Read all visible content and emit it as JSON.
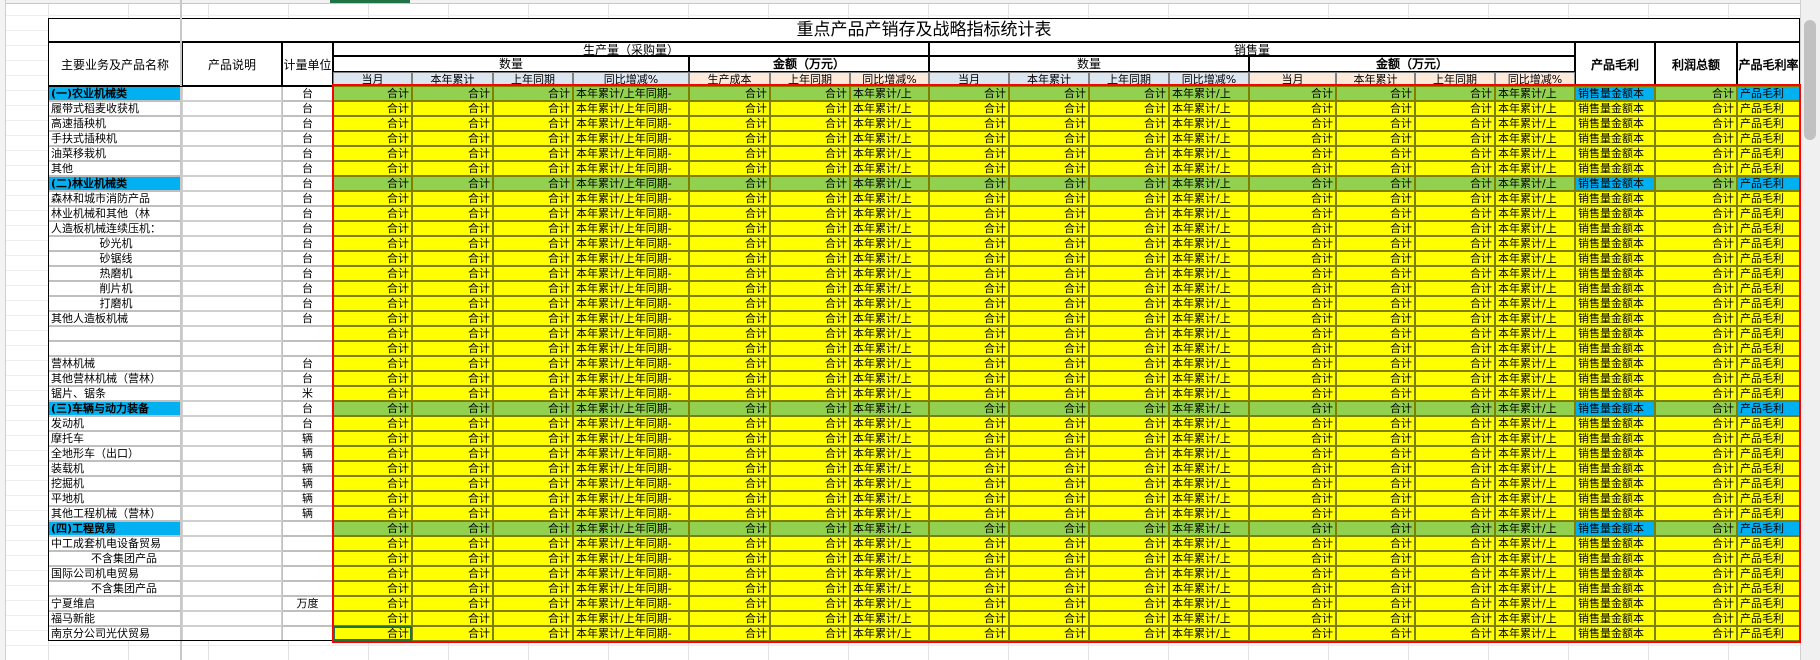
{
  "sheet": {
    "title": "重点产品产销存及战略指标统计表",
    "header": {
      "main_col": "主要业务及产品名称",
      "desc_col": "产品说明",
      "unit_col": "计量单位",
      "production": "生产量（采购量）",
      "sales": "销售量",
      "qty": "数量",
      "amount": "金额（万元）",
      "gross_profit": "产品毛利",
      "profit_total": "利润总额",
      "gross_profit_rate": "产品毛利率",
      "sub_prod": [
        "当月",
        "本年累计",
        "上年同期",
        "同比增减%",
        "生产成本",
        "上年同期",
        "同比增减%"
      ],
      "sub_sales": [
        "当月",
        "本年累计",
        "上年同期",
        "同比增减%",
        "当月",
        "本年累计",
        "上年同期",
        "同比增减%"
      ]
    },
    "cell_text": {
      "sum": "合计",
      "ratio": "本年累计/上年同期-",
      "ratio_short": "本年累计/上",
      "sales_amt": "销售量金额本",
      "gm": "产品毛利"
    },
    "colors": {
      "yellow": "#ffff00",
      "green": "#92d050",
      "blue": "#00b0f0",
      "prod_hdr": "#dce6f1",
      "amt_hdr": "#fde9d9",
      "red_border": "#ff0000"
    },
    "rows": [
      {
        "name": "(一)农业机械类",
        "unit": "台",
        "type": "cat"
      },
      {
        "name": "履带式稻麦收获机",
        "unit": "台",
        "type": "item"
      },
      {
        "name": "高速插秧机",
        "unit": "台",
        "type": "item"
      },
      {
        "name": "手扶式插秧机",
        "unit": "台",
        "type": "item"
      },
      {
        "name": "油菜移栽机",
        "unit": "台",
        "type": "item"
      },
      {
        "name": "其他",
        "unit": "台",
        "type": "item"
      },
      {
        "name": "(二)林业机械类",
        "unit": "台",
        "type": "cat"
      },
      {
        "name": "森林和城市消防产品",
        "unit": "台",
        "type": "item"
      },
      {
        "name": "林业机械和其他（林",
        "unit": "台",
        "type": "item"
      },
      {
        "name": "人造板机械连续压机：",
        "unit": "台",
        "type": "item"
      },
      {
        "name": "砂光机",
        "unit": "台",
        "type": "sub"
      },
      {
        "name": "砂锯线",
        "unit": "台",
        "type": "sub"
      },
      {
        "name": "热磨机",
        "unit": "台",
        "type": "sub"
      },
      {
        "name": "削片机",
        "unit": "台",
        "type": "sub"
      },
      {
        "name": "打磨机",
        "unit": "台",
        "type": "sub"
      },
      {
        "name": "其他人造板机械",
        "unit": "台",
        "type": "item"
      },
      {
        "name": "",
        "unit": "",
        "type": "item"
      },
      {
        "name": "",
        "unit": "",
        "type": "item"
      },
      {
        "name": "营林机械",
        "unit": "台",
        "type": "item"
      },
      {
        "name": "其他营林机械（营林）",
        "unit": "台",
        "type": "item"
      },
      {
        "name": "锯片、锯条",
        "unit": "米",
        "type": "item"
      },
      {
        "name": "(三)车辆与动力装备",
        "unit": "台",
        "type": "cat"
      },
      {
        "name": "发动机",
        "unit": "台",
        "type": "item"
      },
      {
        "name": "摩托车",
        "unit": "辆",
        "type": "item"
      },
      {
        "name": "全地形车（出口）",
        "unit": "辆",
        "type": "item"
      },
      {
        "name": "装载机",
        "unit": "辆",
        "type": "item"
      },
      {
        "name": "挖掘机",
        "unit": "辆",
        "type": "item"
      },
      {
        "name": "平地机",
        "unit": "辆",
        "type": "item"
      },
      {
        "name": "其他工程机械（营林）",
        "unit": "辆",
        "type": "item"
      },
      {
        "name": "(四)工程贸易",
        "unit": "",
        "type": "cat"
      },
      {
        "name": "中工成套机电设备贸易",
        "unit": "",
        "type": "item"
      },
      {
        "name": "不含集团产品",
        "unit": "",
        "type": "sub2"
      },
      {
        "name": "国际公司机电贸易",
        "unit": "",
        "type": "item"
      },
      {
        "name": "不含集团产品",
        "unit": "",
        "type": "sub2"
      },
      {
        "name": "宁夏维启",
        "unit": "万度",
        "type": "item"
      },
      {
        "name": "福马新能",
        "unit": "",
        "type": "item"
      },
      {
        "name": "南京分公司光伏贸易",
        "unit": "",
        "type": "item"
      }
    ]
  }
}
